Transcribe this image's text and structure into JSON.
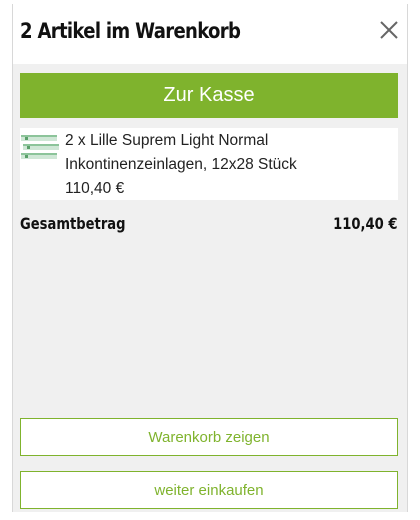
{
  "header": {
    "title": "2 Artikel im Warenkorb",
    "close_icon": "close-icon"
  },
  "checkout": {
    "label": "Zur Kasse"
  },
  "cart": {
    "items": [
      {
        "line1": "2 x Lille Suprem Light Normal",
        "line2": "Inkontinenzeinlagen, 12x28 Stück",
        "price": "110,40 €",
        "thumbnail_icon": "product-thumbnail"
      }
    ]
  },
  "total": {
    "label": "Gesamtbetrag",
    "value": "110,40 €"
  },
  "actions": {
    "view_cart": "Warenkorb zeigen",
    "continue_shopping": "weiter einkaufen"
  },
  "colors": {
    "accent": "#7fb32d",
    "panel_background": "#f0f0f0",
    "text": "#111111"
  }
}
